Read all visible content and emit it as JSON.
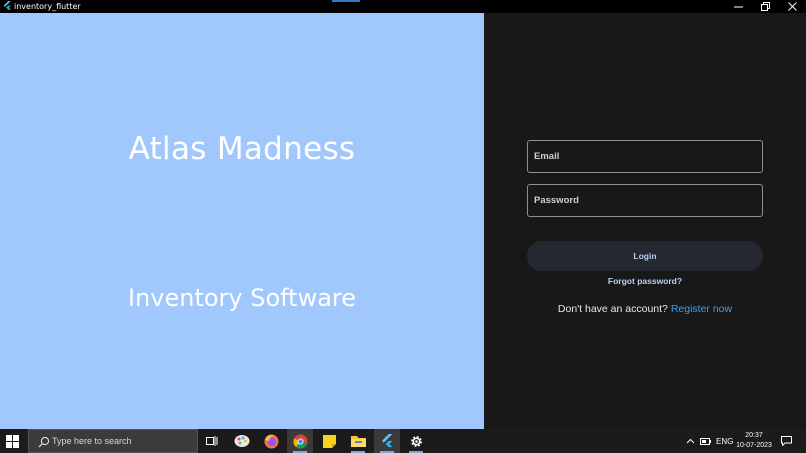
{
  "window": {
    "title": "inventory_flutter",
    "controls": {
      "minimize": "minimize",
      "restore": "restore",
      "close": "close"
    }
  },
  "branding": {
    "title": "Atlas Madness",
    "subtitle": "Inventory Software",
    "background": "#a0c8fd"
  },
  "login": {
    "email_placeholder": "Email",
    "password_placeholder": "Password",
    "login_label": "Login",
    "forgot_label": "Forgot password?",
    "no_account_text": "Don't have an account?",
    "register_label": "Register now",
    "panel_background": "#181818",
    "link_color": "#3f9fe8"
  },
  "taskbar": {
    "search_placeholder": "Type here to search",
    "apps": [
      "task-view-icon",
      "paint-icon",
      "firefox-icon",
      "chrome-icon",
      "sticky-notes-icon",
      "file-explorer-icon",
      "flutter-icon",
      "settings-icon"
    ],
    "language": "ENG",
    "time": "20:37",
    "date": "10-07-2023"
  }
}
